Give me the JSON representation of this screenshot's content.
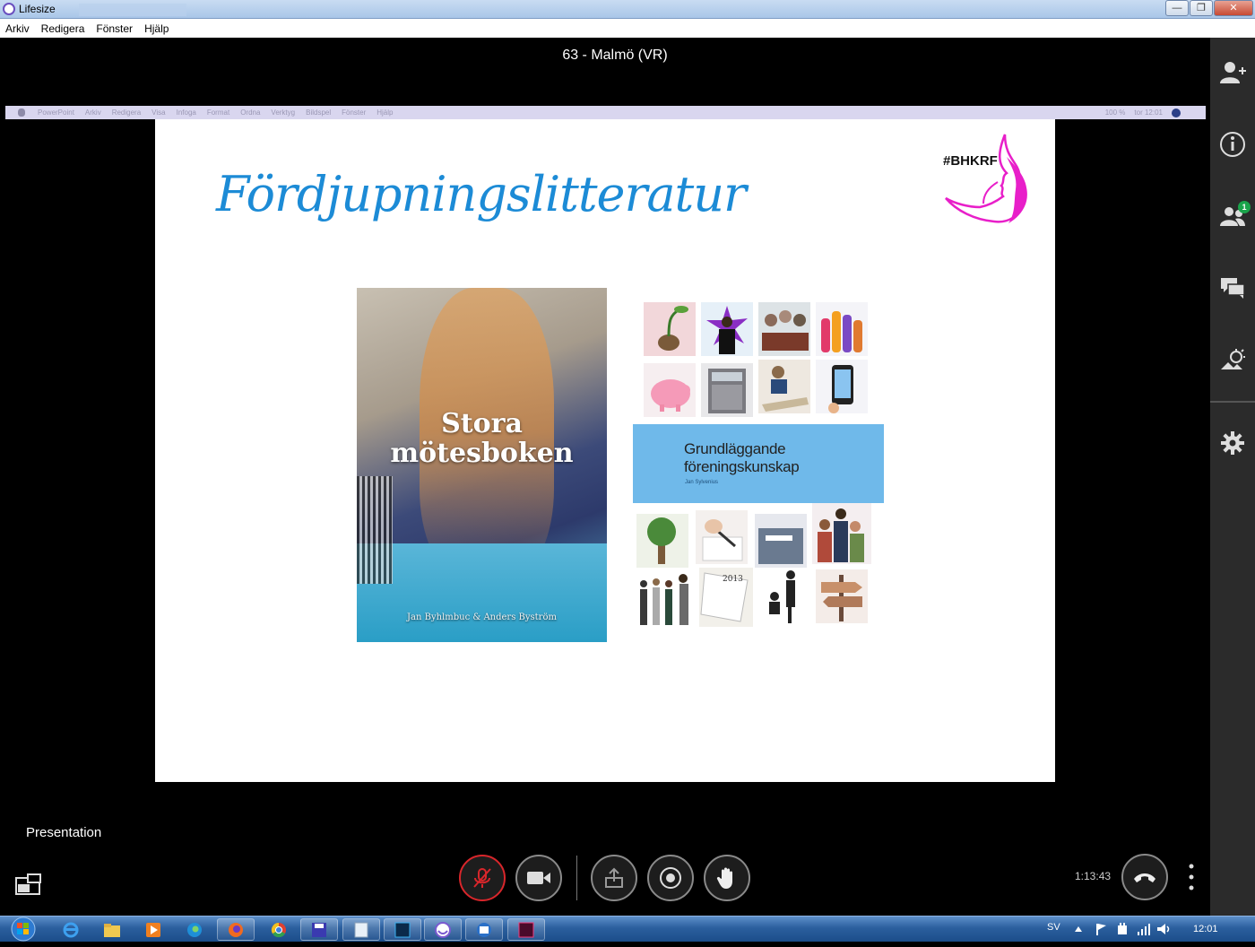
{
  "window": {
    "title": "Lifesize",
    "controls": {
      "minimize": "—",
      "maximize": "❐",
      "close": "✕"
    }
  },
  "menu": [
    "Arkiv",
    "Redigera",
    "Fönster",
    "Hjälp"
  ],
  "meeting": {
    "title": "63 - Malmö (VR)"
  },
  "shared_screen": {
    "menu": [
      "PowerPoint",
      "Arkiv",
      "Redigera",
      "Visa",
      "Infoga",
      "Format",
      "Ordna",
      "Verktyg",
      "Bildspel",
      "Fönster",
      "Hjälp"
    ],
    "status": [
      "100 %",
      "tor 12:01"
    ],
    "slide": {
      "title": "Fördjupningslitteratur",
      "hashtag": "#BHKRF",
      "book1": {
        "title_line1": "Stora",
        "title_line2": "mötesboken",
        "author": "Jan Byhlmbuc & Anders Byström"
      },
      "book2": {
        "title_line1": "Grundläggande",
        "title_line2": "föreningskunskap",
        "author": "Jan Sylvenius",
        "year_tile": "2013"
      }
    }
  },
  "sidebar": {
    "participants_badge": "1"
  },
  "controls": {
    "presentation_label": "Presentation",
    "timer": "1:13:43"
  },
  "colors": {
    "mute_ring": "#d8262b",
    "badge": "#1aa44b",
    "slide_title": "#1c8bd6",
    "book_band": "#6fb9ea",
    "logo_magenta": "#e81fc9"
  },
  "taskbar": {
    "language": "SV",
    "clock": "12:01"
  }
}
